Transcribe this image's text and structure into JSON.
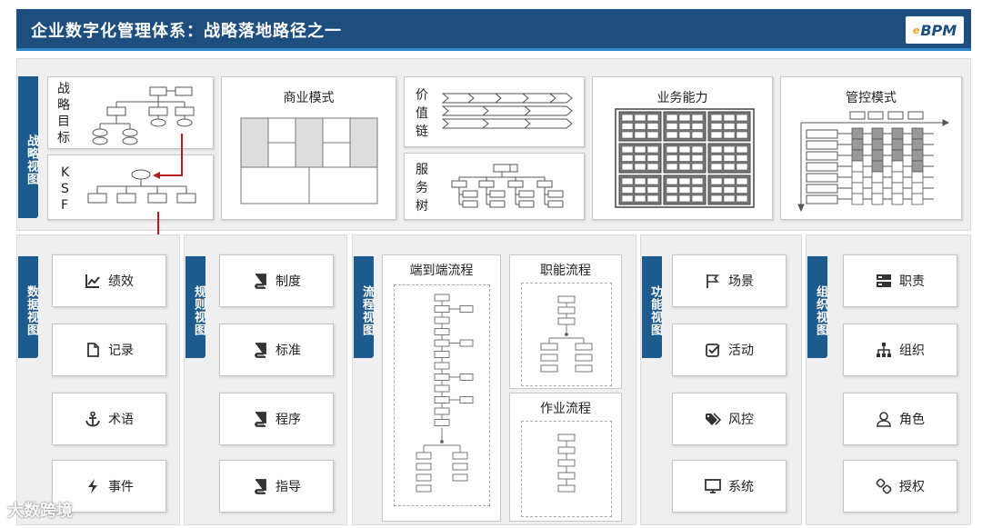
{
  "title": "企业数字化管理体系：战略落地路径之一",
  "logo": {
    "prefix": "e",
    "text": "BPM"
  },
  "strategy_view": {
    "tab": "战略视图",
    "goal_label": "战略目标",
    "ksf_label": "KSF",
    "business_model": "商业模式",
    "value_chain_label": "价值链",
    "service_tree_label": "服务树",
    "business_capability": "业务能力",
    "control_mode": "管控模式"
  },
  "data_view": {
    "tab": "数据视图",
    "items": [
      "绩效",
      "记录",
      "术语",
      "事件"
    ]
  },
  "rule_view": {
    "tab": "规则视图",
    "items": [
      "制度",
      "标准",
      "程序",
      "指导"
    ]
  },
  "process_view": {
    "tab": "流程视图",
    "e2e": "端到端流程",
    "functional": "职能流程",
    "operational": "作业流程"
  },
  "function_view": {
    "tab": "功能视图",
    "items": [
      "场景",
      "活动",
      "风控",
      "系统"
    ]
  },
  "org_view": {
    "tab": "组织视图",
    "items": [
      "职责",
      "组织",
      "角色",
      "授权"
    ]
  },
  "watermark": "大数跨境",
  "colors": {
    "title_bg": "#1d4e7e",
    "accent": "#2b86c5",
    "arrow": "#b02020"
  }
}
